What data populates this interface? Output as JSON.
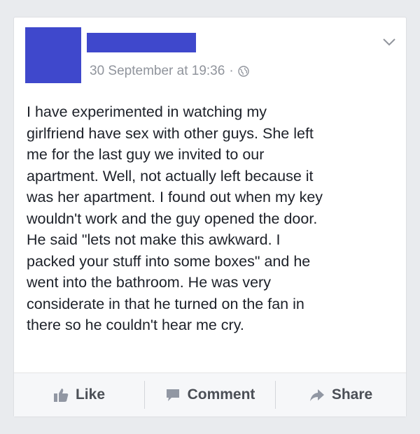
{
  "post": {
    "timestamp": "30 September at 19:36",
    "separator": "·",
    "text": "I have experimented in watching my\ngirlfriend have sex with other guys. She left\nme for the last guy we invited to our\napartment. Well, not actually left because it\nwas her apartment. I found out when my key\nwouldn't work and the guy opened the door.\nHe said \"lets not make this awkward. I\npacked your stuff into some boxes\" and he\nwent into the bathroom. He was very\nconsiderate in that he turned on the fan in\nthere so he couldn't hear me cry."
  },
  "actions": {
    "like": "Like",
    "comment": "Comment",
    "share": "Share"
  },
  "icons": {
    "privacy": "globe-icon",
    "menu": "chevron-down-icon",
    "like": "thumbs-up-icon",
    "comment": "speech-bubble-icon",
    "share": "share-arrow-icon"
  },
  "colors": {
    "redaction": "#3f48cc",
    "meta_text": "#90949c",
    "body_text": "#1d2129",
    "action_text": "#4b4f56"
  }
}
